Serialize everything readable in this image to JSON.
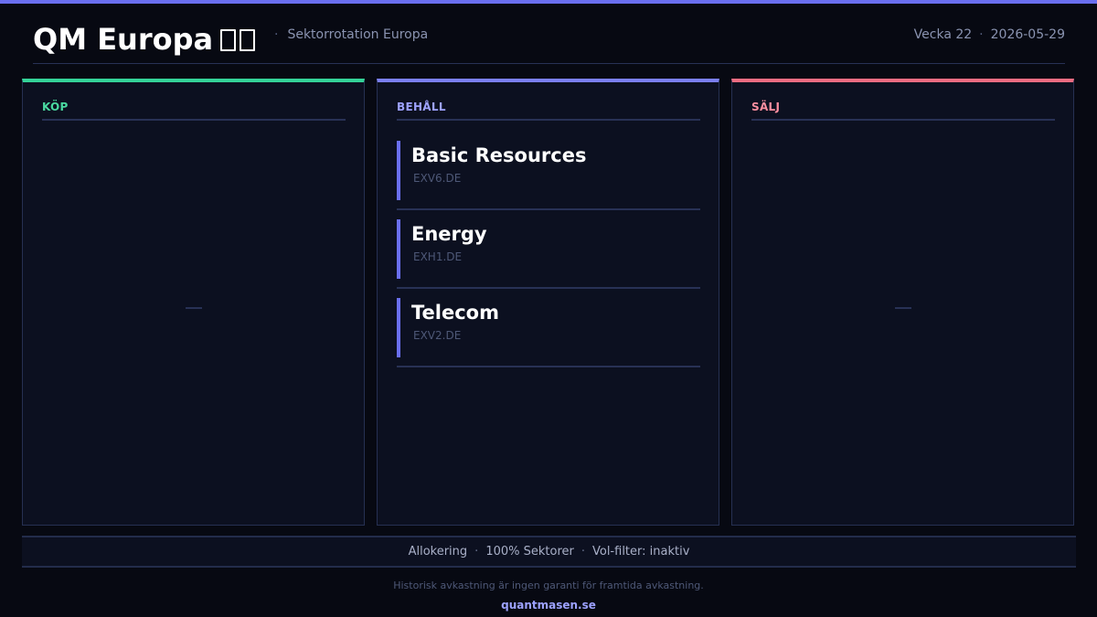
{
  "header": {
    "title": "QM Europa",
    "flag_icon": "flag-icon",
    "subtitle_separator": "·",
    "subtitle": "Sektorrotation Europa",
    "week": "Vecka 22",
    "date_separator": "·",
    "date": "2026-05-29"
  },
  "columns": {
    "buy": {
      "label": "KÖP",
      "accent": "#34d399",
      "items": []
    },
    "hold": {
      "label": "BEHÅLL",
      "accent": "#7b7ff5",
      "items": [
        {
          "name": "Basic Resources",
          "ticker": "EXV6.DE"
        },
        {
          "name": "Energy",
          "ticker": "EXH1.DE"
        },
        {
          "name": "Telecom",
          "ticker": "EXV2.DE"
        }
      ]
    },
    "sell": {
      "label": "SÄLJ",
      "accent": "#f06c82",
      "items": []
    }
  },
  "footer": {
    "allocation": "Allokering",
    "sep1": "·",
    "sectors": "100% Sektorer",
    "sep2": "·",
    "vol_filter": "Vol-filter: inaktiv",
    "disclaimer": "Historisk avkastning är ingen garanti för framtida avkastning.",
    "brand": "quantmasen.se"
  },
  "colors": {
    "background": "#070912",
    "accent": "#6a6ff0",
    "buy": "#34d399",
    "hold": "#7b7ff5",
    "sell": "#f06c82"
  }
}
